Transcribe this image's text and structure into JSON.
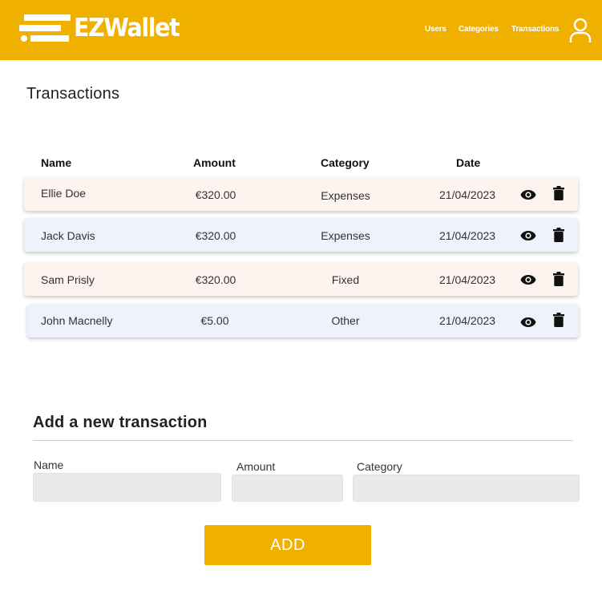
{
  "header": {
    "brand": "EZWallet",
    "colors": {
      "brand": "#EFB000",
      "text": "#FFFFFF"
    },
    "nav": {
      "users": "Users",
      "categories": "Categories",
      "transactions": "Transactions"
    },
    "user_icon": "user-icon"
  },
  "page_title": "Transactions",
  "table": {
    "headers": {
      "name": "Name",
      "amount": "Amount",
      "category": "Category",
      "date": "Date"
    },
    "rows": [
      {
        "name": "Ellie Doe",
        "amount": "€320.00",
        "category": "Expenses",
        "date": "21/04/2023",
        "color": "#FDF4EF"
      },
      {
        "name": "Jack Davis",
        "amount": "€320.00",
        "category": "Expenses",
        "date": "21/04/2023",
        "color": "#EEF2FC"
      },
      {
        "name": "Sam Prisly",
        "amount": "€320.00",
        "category": "Fixed",
        "date": "21/04/2023",
        "color": "#FDF4EF"
      },
      {
        "name": "John Macnelly",
        "amount": "€5.00",
        "category": "Other",
        "date": "21/04/2023",
        "color": "#EEF2FC"
      }
    ],
    "row_actions": [
      "eye-icon",
      "trash-icon"
    ]
  },
  "add_form": {
    "title": "Add a new transaction",
    "labels": {
      "name": "Name",
      "amount": "Amount",
      "category": "Category"
    },
    "values": {
      "name": "",
      "amount": "",
      "category": ""
    },
    "button": "ADD"
  }
}
